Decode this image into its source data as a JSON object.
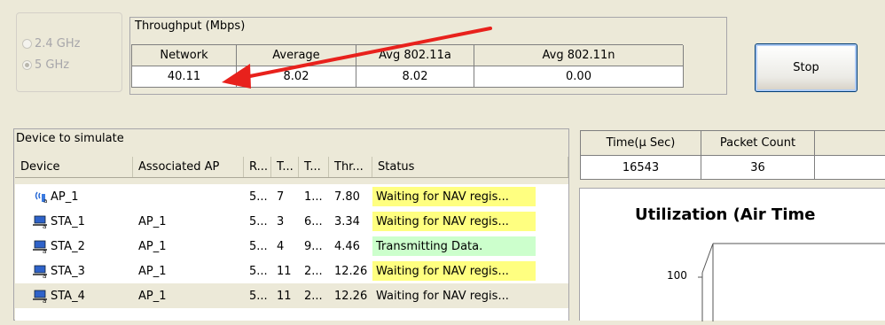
{
  "band": {
    "options": [
      {
        "label": "2.4 GHz",
        "selected": false
      },
      {
        "label": "5 GHz",
        "selected": true
      }
    ]
  },
  "throughput": {
    "caption": "Throughput (Mbps)",
    "headers": [
      "Network",
      "Average",
      "Avg 802.11a",
      "Avg 802.11n"
    ],
    "values": [
      "40.11",
      "8.02",
      "8.02",
      "0.00"
    ]
  },
  "stop_button": "Stop",
  "device_panel": {
    "caption": "Device to simulate",
    "headers": [
      "Device",
      "Associated AP",
      "R...",
      "T...",
      "T...",
      "Thr...",
      "Status"
    ],
    "rows": [
      {
        "device": "AP_1",
        "icon": "access-point-icon",
        "ap": "",
        "r": "5...",
        "t1": "7",
        "t2": "1...",
        "thr": "7.80",
        "status": "Waiting for NAV regis...",
        "status_color": "#ffff80"
      },
      {
        "device": "STA_1",
        "icon": "laptop-station-icon",
        "ap": "AP_1",
        "r": "5...",
        "t1": "3",
        "t2": "6...",
        "thr": "3.34",
        "status": "Waiting for NAV regis...",
        "status_color": "#ffff80"
      },
      {
        "device": "STA_2",
        "icon": "laptop-station-icon",
        "ap": "AP_1",
        "r": "5...",
        "t1": "4",
        "t2": "9...",
        "thr": "4.46",
        "status": "Transmitting Data.",
        "status_color": "#ccffcc"
      },
      {
        "device": "STA_3",
        "icon": "laptop-station-icon",
        "ap": "AP_1",
        "r": "5...",
        "t1": "11",
        "t2": "2...",
        "thr": "12.26",
        "status": "Waiting for NAV regis...",
        "status_color": "#ffff80"
      },
      {
        "device": "STA_4",
        "icon": "laptop-station-icon",
        "ap": "AP_1",
        "r": "5...",
        "t1": "11",
        "t2": "2...",
        "thr": "12.26",
        "status": "Waiting for NAV regis...",
        "status_color": ""
      }
    ]
  },
  "stats": {
    "headers": [
      "Time(μ Sec)",
      "Packet Count",
      ""
    ],
    "values": [
      "16543",
      "36",
      ""
    ]
  },
  "chart": {
    "title": "Utilization (Air Time",
    "y_tick": "100"
  },
  "annotation": {
    "arrow_color": "#e8211c"
  }
}
